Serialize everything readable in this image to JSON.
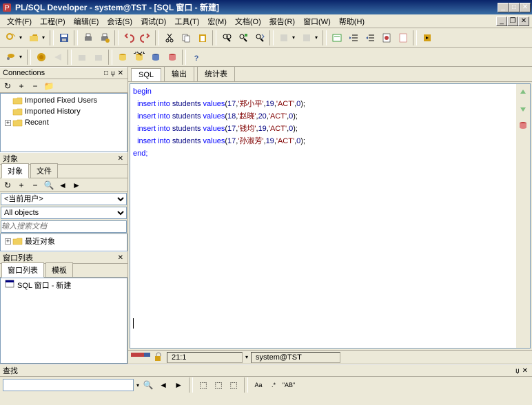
{
  "title": "PL/SQL Developer - system@TST - [SQL 窗口 - 新建]",
  "menu": {
    "file": "文件(F)",
    "project": "工程(P)",
    "edit": "编辑(E)",
    "session": "会话(S)",
    "debug": "调试(D)",
    "tool": "工具(T)",
    "macro": "宏(M)",
    "doc": "文档(O)",
    "report": "报告(R)",
    "window": "窗口(W)",
    "help": "帮助(H)"
  },
  "left": {
    "connections_title": "Connections",
    "tree": {
      "n1": "Imported Fixed Users",
      "n2": "Imported History",
      "n3": "Recent"
    },
    "objects_title": "对象",
    "obj_tab1": "对象",
    "obj_tab2": "文件",
    "schema_sel": "<当前用户>",
    "filter_sel": "All objects",
    "search_ph": "输入搜索文档",
    "recent_obj": "最近对象",
    "winlist_title": "窗口列表",
    "wl_tab1": "窗口列表",
    "wl_tab2": "模板",
    "wl_item": "SQL 窗口 - 新建"
  },
  "editor": {
    "tab_sql": "SQL",
    "tab_out": "输出",
    "tab_stats": "统计表",
    "code": {
      "l1": "begin",
      "l2a": "  insert ",
      "l2b": "into ",
      "l2c": "students ",
      "l2d": "values",
      "l2e": "(",
      "l2f": "17",
      "l2g": ",",
      "l2h": "'郑小平'",
      "l2i": ",",
      "l2j": "19",
      "l2k": ",",
      "l2l": "'ACT'",
      "l2m": ",",
      "l2n": "0",
      "l2o": ");",
      "l3f": "18",
      "l3h": "'赵晓'",
      "l3j": "20",
      "l4f": "17",
      "l4h": "'钱均'",
      "l4j": "19",
      "l5f": "17",
      "l5h": "'孙淑芳'",
      "l5j": "19",
      "l6": "end;"
    }
  },
  "status": {
    "pos": "21:1",
    "conn": "system@TST"
  },
  "find": {
    "label": "查找"
  }
}
